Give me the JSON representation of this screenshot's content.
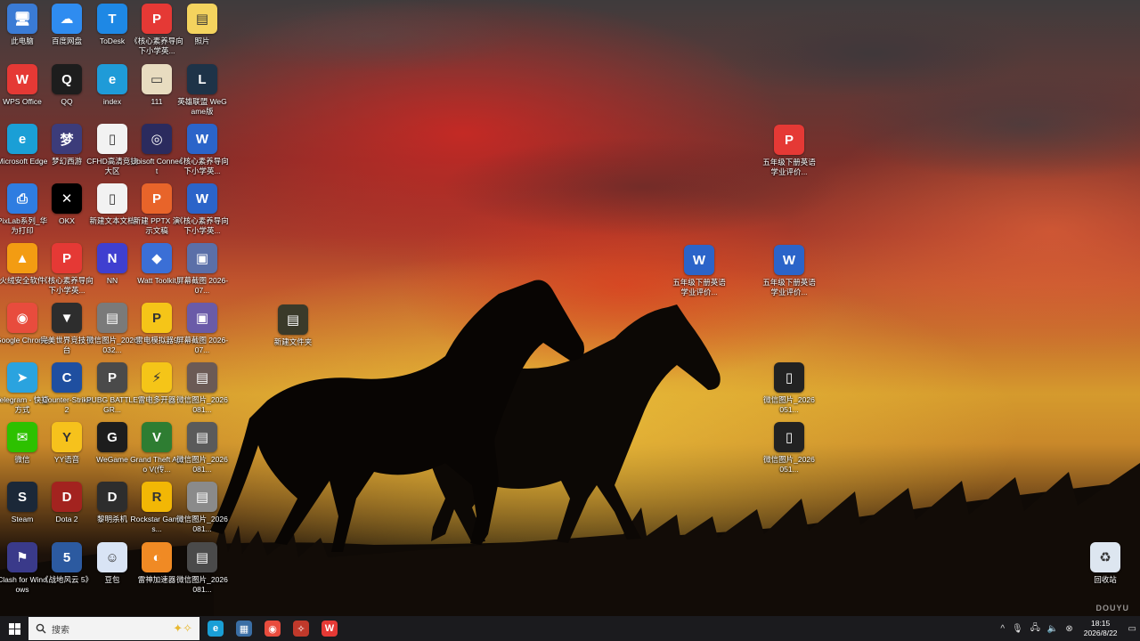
{
  "desktop": {
    "icons": [
      {
        "label": "此电脑",
        "glyph": "🖥",
        "color": "#3a7bd5"
      },
      {
        "label": "百度网盘",
        "glyph": "☁",
        "color": "#2f8cf0"
      },
      {
        "label": "ToDesk",
        "glyph": "T",
        "color": "#1e88e5"
      },
      {
        "label": "《核心素养导向下小学英...",
        "glyph": "P",
        "color": "#e53935"
      },
      {
        "label": "照片",
        "glyph": "▤",
        "color": "#f4d35e"
      },
      {
        "label": "WPS Office",
        "glyph": "W",
        "color": "#e53935"
      },
      {
        "label": "QQ",
        "glyph": "Q",
        "color": "#1d1d1d"
      },
      {
        "label": "index",
        "glyph": "e",
        "color": "#1f9bd8"
      },
      {
        "label": "111",
        "glyph": "▭",
        "color": "#e8dcc0"
      },
      {
        "label": "英雄联盟 WeGame版",
        "glyph": "L",
        "color": "#1e3348"
      },
      {
        "label": "Microsoft Edge",
        "glyph": "e",
        "color": "#1a9fd6"
      },
      {
        "label": "梦幻西游",
        "glyph": "梦",
        "color": "#3c3c7a"
      },
      {
        "label": "CFHD高清竞技大区",
        "glyph": "▯",
        "color": "#f2f2f2"
      },
      {
        "label": "Ubisoft Connect",
        "glyph": "◎",
        "color": "#2b2b5e"
      },
      {
        "label": "《核心素养导向下小学英...",
        "glyph": "W",
        "color": "#2b64c9"
      },
      {
        "label": "PixLab系列_华为打印",
        "glyph": "⎙",
        "color": "#2f7de1"
      },
      {
        "label": "OKX",
        "glyph": "✕",
        "color": "#000000"
      },
      {
        "label": "新建文本文档",
        "glyph": "▯",
        "color": "#f2f2f2"
      },
      {
        "label": "新建 PPTX 演示文稿",
        "glyph": "P",
        "color": "#e8642a"
      },
      {
        "label": "《核心素养导向下小学英...",
        "glyph": "W",
        "color": "#2b64c9"
      },
      {
        "label": "火绒安全软件",
        "glyph": "▲",
        "color": "#f39c12"
      },
      {
        "label": "《核心素养导向下小学英...",
        "glyph": "P",
        "color": "#e53935"
      },
      {
        "label": "NN",
        "glyph": "N",
        "color": "#3f3fd0"
      },
      {
        "label": "Watt Toolkit",
        "glyph": "◆",
        "color": "#3b6fd6"
      },
      {
        "label": "屏幕截图 2026-07...",
        "glyph": "▣",
        "color": "#5b6fa8"
      },
      {
        "label": "Google Chrome",
        "glyph": "◉",
        "color": "#e84c3d"
      },
      {
        "label": "完美世界竞技平台",
        "glyph": "▼",
        "color": "#2d2d2d"
      },
      {
        "label": "微信图片_2026032...",
        "glyph": "▤",
        "color": "#7a7a7a"
      },
      {
        "label": "雷电模拟器9",
        "glyph": "P",
        "color": "#f5c518"
      },
      {
        "label": "屏幕截图 2026-07...",
        "glyph": "▣",
        "color": "#6a5ba8"
      },
      {
        "label": "Telegram - 快捷方式",
        "glyph": "➤",
        "color": "#2aa3df"
      },
      {
        "label": "Counter-Strike 2",
        "glyph": "C",
        "color": "#1f4fa0"
      },
      {
        "label": "PUBG BATTLEGR...",
        "glyph": "P",
        "color": "#4a4a4a"
      },
      {
        "label": "雷电多开器",
        "glyph": "⚡",
        "color": "#f5c518"
      },
      {
        "label": "微信图片_2026081...",
        "glyph": "▤",
        "color": "#6b5a55"
      },
      {
        "label": "微信",
        "glyph": "✉",
        "color": "#2dc100"
      },
      {
        "label": "YY语音",
        "glyph": "Y",
        "color": "#f6c21c"
      },
      {
        "label": "WeGame",
        "glyph": "G",
        "color": "#1d1d1d"
      },
      {
        "label": "Grand Theft Auto V(传...",
        "glyph": "V",
        "color": "#2e7d32"
      },
      {
        "label": "微信图片_2026081...",
        "glyph": "▤",
        "color": "#5a5a5a"
      },
      {
        "label": "Steam",
        "glyph": "S",
        "color": "#1b2838"
      },
      {
        "label": "Dota 2",
        "glyph": "D",
        "color": "#a3231f"
      },
      {
        "label": "黎明杀机",
        "glyph": "D",
        "color": "#2d2d2d"
      },
      {
        "label": "Rockstar Games...",
        "glyph": "R",
        "color": "#f2b705"
      },
      {
        "label": "微信图片_2026081...",
        "glyph": "▤",
        "color": "#8a8a8a"
      },
      {
        "label": "Clash for Windows",
        "glyph": "⚑",
        "color": "#3a3a8a"
      },
      {
        "label": "《战地风云 5》",
        "glyph": "5",
        "color": "#2c5aa0"
      },
      {
        "label": "豆包",
        "glyph": "☺",
        "color": "#d9e4f5"
      },
      {
        "label": "雷神加速器",
        "glyph": "◐",
        "color": "#f08a24"
      },
      {
        "label": "微信图片_2026081...",
        "glyph": "▤",
        "color": "#4a4a4a"
      },
      {
        "label": "新建文件夹",
        "glyph": "▤",
        "color": "#3a3a2a"
      },
      {
        "label": "五年级下册英语学业评价...",
        "glyph": "P",
        "color": "#e53935"
      },
      {
        "label": "五年级下册英语学业评价...",
        "glyph": "W",
        "color": "#2b64c9"
      },
      {
        "label": "五年级下册英语学业评价...",
        "glyph": "W",
        "color": "#2b64c9"
      },
      {
        "label": "微信图片_2026051...",
        "glyph": "▯",
        "color": "#222222"
      },
      {
        "label": "微信图片_2026051...",
        "glyph": "▯",
        "color": "#222222"
      },
      {
        "label": "回收站",
        "glyph": "♻",
        "color": "#dde6f0"
      }
    ]
  },
  "taskbar": {
    "search_placeholder": "搜索",
    "apps": [
      {
        "name": "edge-icon",
        "glyph": "e",
        "color": "#1a9fd6"
      },
      {
        "name": "calculator-icon",
        "glyph": "▦",
        "color": "#3a6ea5"
      },
      {
        "name": "chrome-icon",
        "glyph": "◉",
        "color": "#e84c3d"
      },
      {
        "name": "game-launcher-icon",
        "glyph": "✧",
        "color": "#c0392b"
      },
      {
        "name": "wps-icon",
        "glyph": "W",
        "color": "#e53935"
      }
    ],
    "clock_time": "18:15",
    "clock_date": "2026/8/22"
  },
  "watermark": "DOUYU"
}
